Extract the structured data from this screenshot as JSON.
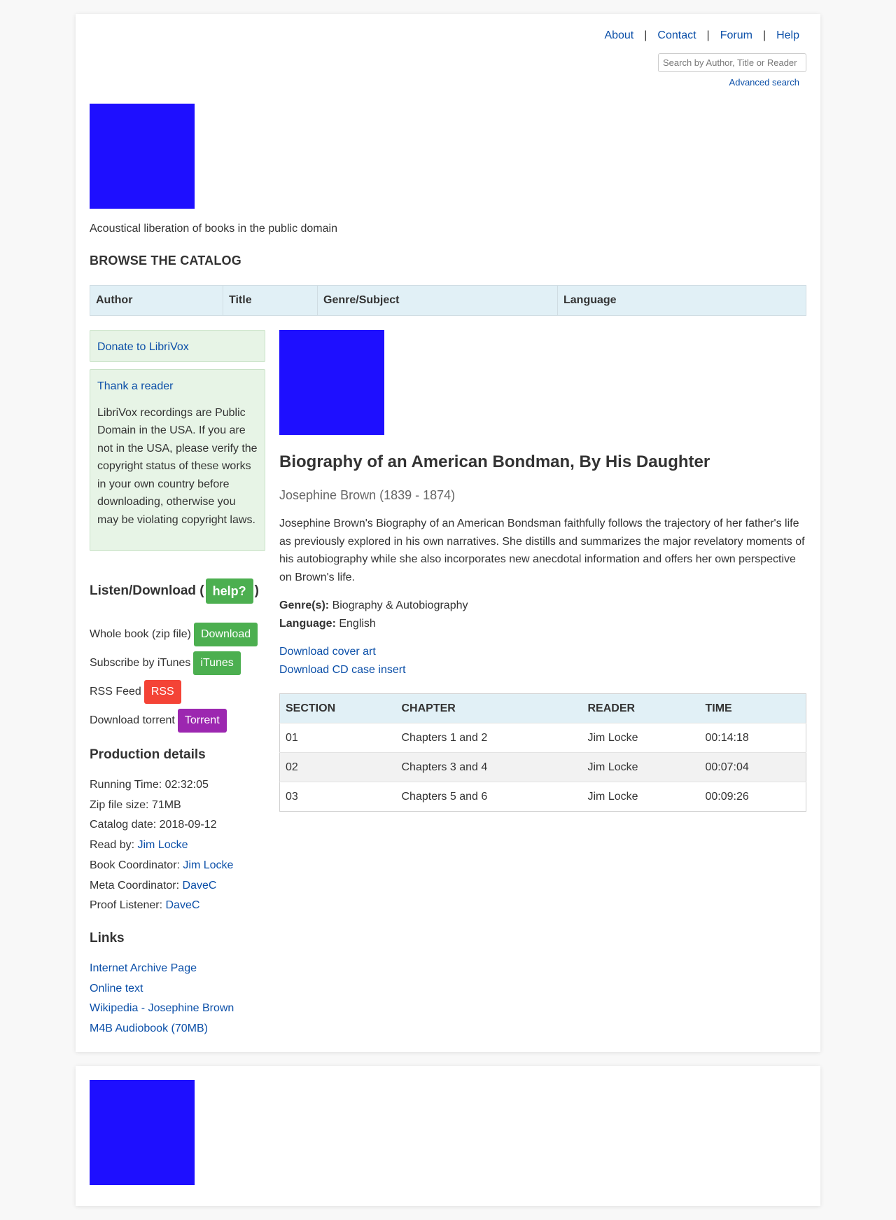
{
  "nav": {
    "about": "About",
    "contact": "Contact",
    "forum": "Forum",
    "help": "Help",
    "separator": "|",
    "search_placeholder": "Search by Author, Title or Reader",
    "advanced_search": "Advanced search"
  },
  "logo_color": "#1e0fff",
  "tagline": "Acoustical liberation of books in the public domain",
  "browse": {
    "title": "BROWSE THE CATALOG",
    "tabs": [
      "Author",
      "Title",
      "Genre/Subject",
      "Language"
    ]
  },
  "sidebar": {
    "donate": "Donate to LibriVox",
    "thank": "Thank a reader",
    "copyright_note": "LibriVox recordings are Public Domain in the USA. If you are not in the USA, please verify the copyright status of these works in your own country before downloading, otherwise you may be violating copyright laws.",
    "listen": {
      "heading_pre": "Listen/Download (",
      "help": "help?",
      "heading_post": ")"
    },
    "downloads": [
      {
        "label": "Whole book (zip file)",
        "button": "Download",
        "color": "#4caf50"
      },
      {
        "label": "Subscribe by iTunes",
        "button": "iTunes",
        "color": "#4caf50"
      },
      {
        "label": "RSS Feed",
        "button": "RSS",
        "color": "#f44336"
      },
      {
        "label": "Download torrent",
        "button": "Torrent",
        "color": "#9c27b0"
      }
    ],
    "production": {
      "heading": "Production details",
      "running_time": "Running Time: 02:32:05",
      "zip_size": "Zip file size: 71MB",
      "catalog_date": "Catalog date: 2018-09-12",
      "read_by_label": "Read by: ",
      "read_by": "Jim Locke",
      "book_coord_label": "Book Coordinator: ",
      "book_coord": "Jim Locke",
      "meta_coord_label": "Meta Coordinator: ",
      "meta_coord": "DaveC",
      "proof_label": "Proof Listener: ",
      "proof": "DaveC"
    },
    "links": {
      "heading": "Links",
      "items": [
        "Internet Archive Page",
        "Online text",
        "Wikipedia - Josephine Brown",
        "M4B Audiobook (70MB)"
      ]
    }
  },
  "book": {
    "title": "Biography of an American Bondman, By His Daughter",
    "author": "Josephine Brown (1839 - 1874)",
    "description": "Josephine Brown's Biography of an American Bondsman faithfully follows the trajectory of her father's life as previously explored in his own narratives. She distills and summarizes the major revelatory moments of his autobiography while she also incorporates new anecdotal information and offers her own perspective on Brown's life.",
    "genre_label": "Genre(s):",
    "genre": "Biography & Autobiography",
    "language_label": "Language:",
    "language": "English",
    "cover_art_link": "Download cover art",
    "cd_insert_link": "Download CD case insert"
  },
  "sections_table": {
    "headers": [
      "SECTION",
      "CHAPTER",
      "READER",
      "TIME"
    ],
    "rows": [
      [
        "01",
        "Chapters 1 and 2",
        "Jim Locke",
        "00:14:18"
      ],
      [
        "02",
        "Chapters 3 and 4",
        "Jim Locke",
        "00:07:04"
      ],
      [
        "03",
        "Chapters 5 and 6",
        "Jim Locke",
        "00:09:26"
      ]
    ]
  }
}
